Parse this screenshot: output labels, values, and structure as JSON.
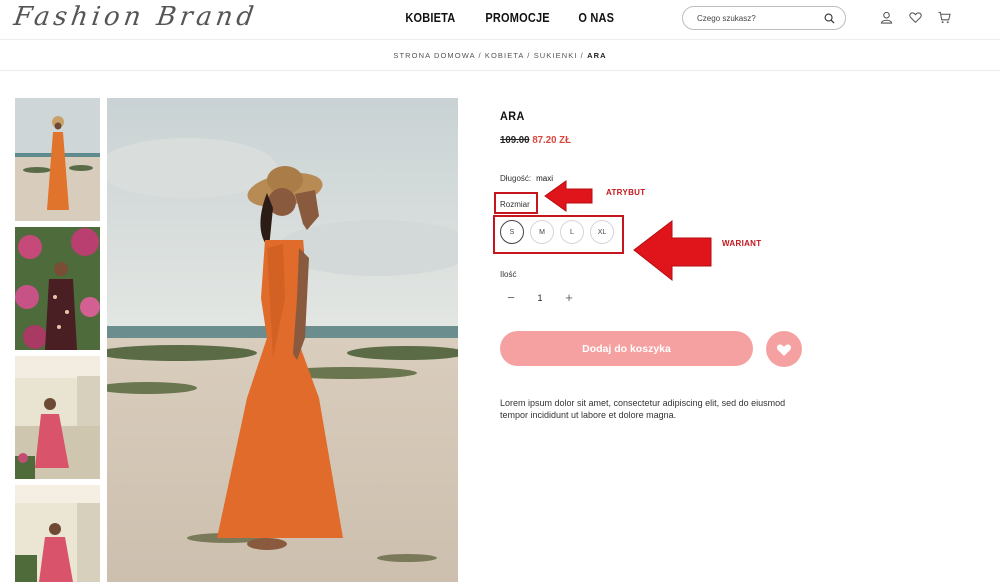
{
  "header": {
    "logo": "Fashion Brand",
    "nav": [
      "KOBIETA",
      "PROMOCJE",
      "O NAS"
    ],
    "search_placeholder": "Czego szukasz?",
    "icons": [
      "user-icon",
      "heart-icon",
      "cart-icon"
    ]
  },
  "breadcrumb": {
    "items": [
      "STRONA DOMOWA",
      "KOBIETA",
      "SUKIENKI"
    ],
    "separator": " / ",
    "current": "ARA"
  },
  "product": {
    "title": "ARA",
    "old_price": "109.00",
    "new_price": "87.20 ZŁ",
    "length_label": "Długość:",
    "length_value": "maxi",
    "size_label": "Rozmiar",
    "sizes": [
      "S",
      "M",
      "L",
      "XL"
    ],
    "selected_size": "S",
    "qty_label": "Ilość",
    "qty_minus": "−",
    "qty_value": "1",
    "qty_plus": "+",
    "add_to_cart": "Dodaj do koszyka",
    "description": "Lorem ipsum dolor sit amet, consectetur adipiscing elit, sed do eiusmod tempor incididunt ut labore et dolore magna."
  },
  "annotations": {
    "attribute": "ATRYBUT",
    "variant": "WARIANT"
  },
  "colors": {
    "accent_pink": "#f6a1a1",
    "sale_red": "#d9463b",
    "annotation_red": "#c4161c"
  }
}
